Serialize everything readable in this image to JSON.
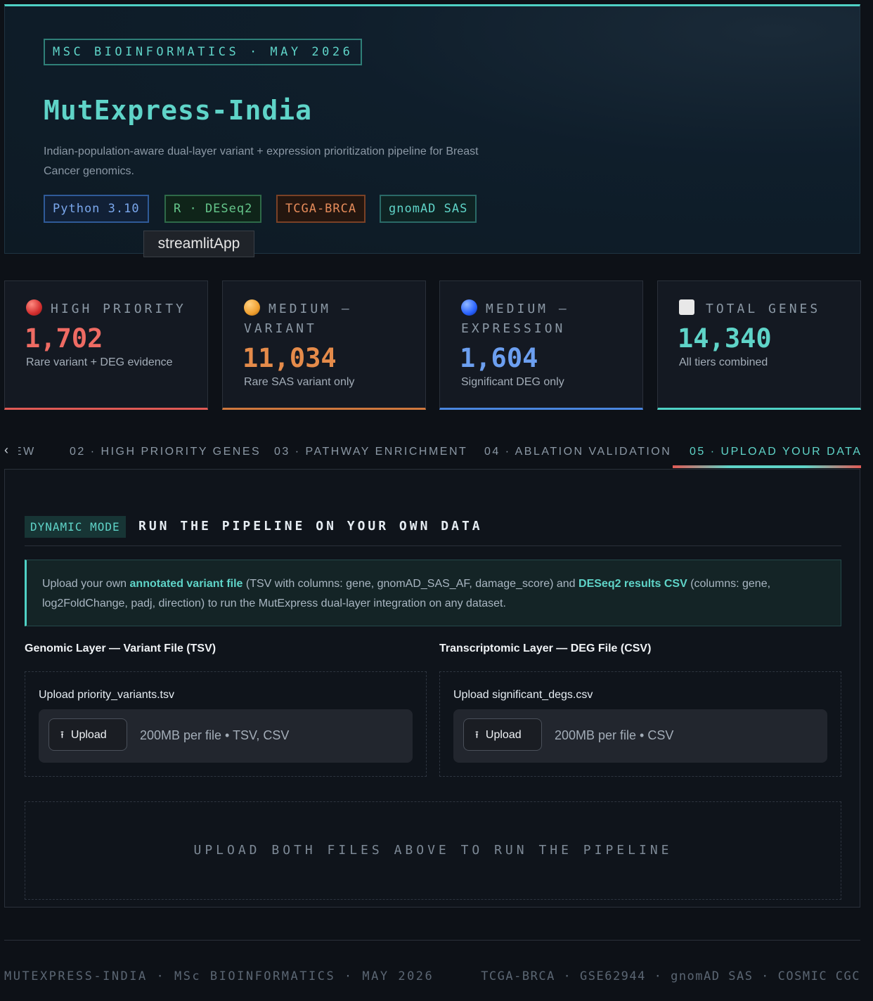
{
  "hero": {
    "tag": "MSC BIOINFORMATICS · MAY 2026",
    "title": "MutExpress-India",
    "description": "Indian-population-aware dual-layer variant + expression prioritization pipeline for Breast Cancer genomics.",
    "badges": [
      "Python 3.10",
      "R · DESeq2",
      "TCGA-BRCA",
      "gnomAD SAS"
    ],
    "tooltip": "streamlitApp"
  },
  "metrics": [
    {
      "icon": "red-circle-icon",
      "label": "HIGH PRIORITY",
      "value": "1,702",
      "sub": "Rare variant + DEG evidence",
      "color": "#e05a55"
    },
    {
      "icon": "orange-circle-icon",
      "label": "MEDIUM — VARIANT",
      "value": "11,034",
      "sub": "Rare SAS variant only",
      "color": "#d0783e"
    },
    {
      "icon": "blue-circle-icon",
      "label": "MEDIUM — EXPRESSION",
      "value": "1,604",
      "sub": "Significant DEG only",
      "color": "#4a86e0"
    },
    {
      "icon": "white-square-icon",
      "label": "TOTAL GENES",
      "value": "14,340",
      "sub": "All tiers combined",
      "color": "#4fd1c5"
    }
  ],
  "tabs": {
    "scroll_left": "‹",
    "items": [
      "EW",
      "02 · HIGH PRIORITY GENES",
      "03 · PATHWAY ENRICHMENT",
      "04 · ABLATION VALIDATION",
      "05 · UPLOAD YOUR DATA"
    ],
    "active_index": 4
  },
  "upload": {
    "mode_chip": "DYNAMIC MODE",
    "mode_title": "RUN THE PIPELINE ON YOUR OWN DATA",
    "info_prefix": "Upload your own ",
    "info_variant": "annotated variant file",
    "info_mid": " (TSV with columns: gene, gnomAD_SAS_AF, damage_score) and ",
    "info_deseq": "DESeq2 results CSV",
    "info_suffix": " (columns: gene, log2FoldChange, padj, direction) to run the MutExpress dual-layer integration on any dataset.",
    "genomic": {
      "title": "Genomic Layer — Variant File (TSV)",
      "label": "Upload priority_variants.tsv",
      "button": "Upload",
      "hint": "200MB per file • TSV, CSV"
    },
    "transcriptomic": {
      "title": "Transcriptomic Layer — DEG File (CSV)",
      "label": "Upload significant_degs.csv",
      "button": "Upload",
      "hint": "200MB per file • CSV"
    },
    "run_message": "UPLOAD BOTH FILES ABOVE TO RUN THE PIPELINE"
  },
  "footer": {
    "left": "MUTEXPRESS-INDIA · MSc BIOINFORMATICS · MAY 2026",
    "right": "TCGA-BRCA · GSE62944 · gnomAD SAS · COSMIC CGC"
  }
}
